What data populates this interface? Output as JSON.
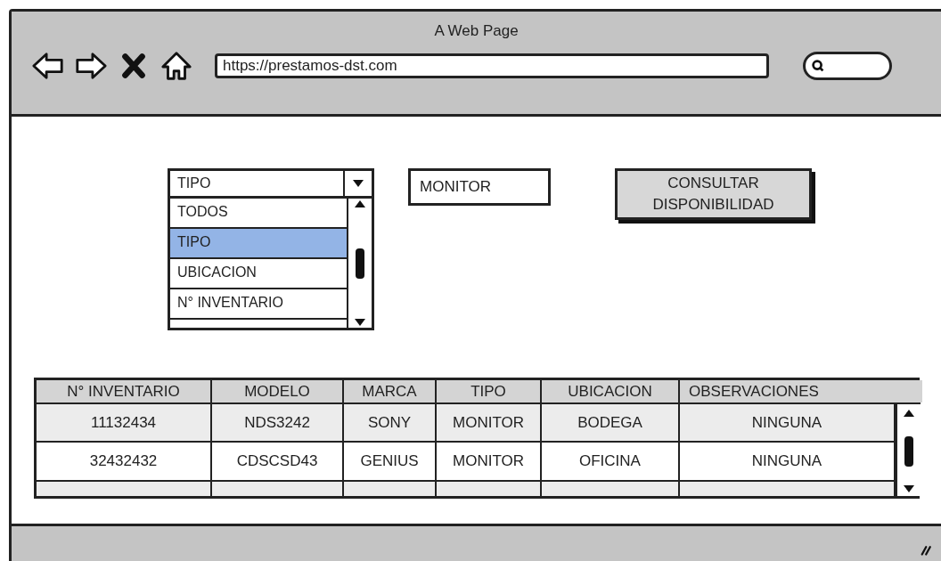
{
  "window": {
    "title": "A Web Page"
  },
  "address_bar": {
    "value": "https://prestamos-dst.com"
  },
  "filter_dropdown": {
    "value": "TIPO",
    "expanded": true,
    "options": [
      {
        "label": "TODOS",
        "selected": false
      },
      {
        "label": "TIPO",
        "selected": true
      },
      {
        "label": "UBICACION",
        "selected": false
      },
      {
        "label": "N° INVENTARIO",
        "selected": false
      }
    ]
  },
  "filter_value": {
    "value": "MONITOR"
  },
  "button": {
    "label": "CONSULTAR DISPONIBILIDAD"
  },
  "table": {
    "columns": [
      "N° INVENTARIO",
      "MODELO",
      "MARCA",
      "TIPO",
      "UBICACION",
      "OBSERVACIONES"
    ],
    "rows": [
      [
        "11132434",
        "NDS3242",
        "SONY",
        "MONITOR",
        "BODEGA",
        "NINGUNA"
      ],
      [
        "32432432",
        "CDSCSD43",
        "GENIUS",
        "MONITOR",
        "OFICINA",
        "NINGUNA"
      ]
    ]
  }
}
